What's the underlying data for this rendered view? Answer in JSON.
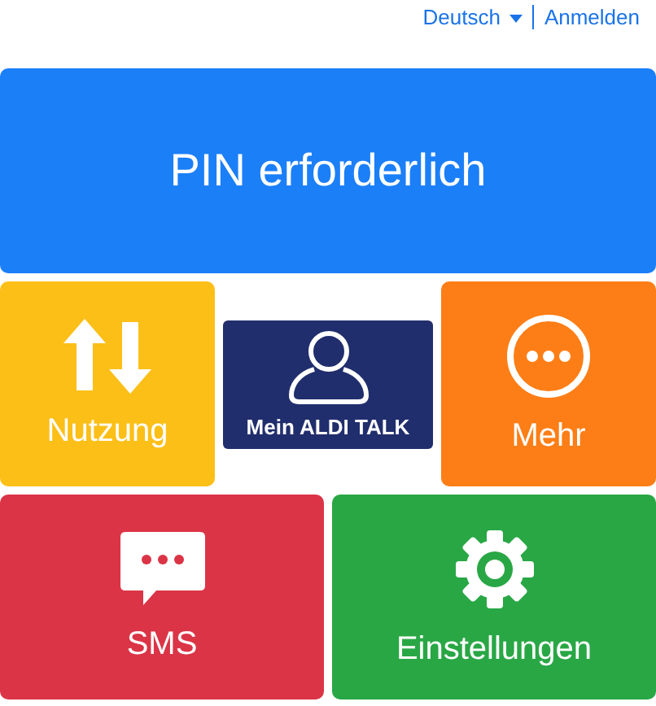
{
  "header": {
    "language": "Deutsch",
    "login": "Anmelden"
  },
  "tiles": [
    {
      "kind": "banner",
      "label": "PIN erforderlich",
      "color": "#1b7ff8"
    },
    {
      "kind": "usage",
      "label": "Nutzung",
      "color": "#fcbf17"
    },
    {
      "kind": "account",
      "label": "Mein ALDI TALK",
      "color": "#212e6d"
    },
    {
      "kind": "more",
      "label": "Mehr",
      "color": "#fd7e16"
    },
    {
      "kind": "sms",
      "label": "SMS",
      "color": "#db3446"
    },
    {
      "kind": "settings",
      "label": "Einstellungen",
      "color": "#29a745"
    }
  ]
}
